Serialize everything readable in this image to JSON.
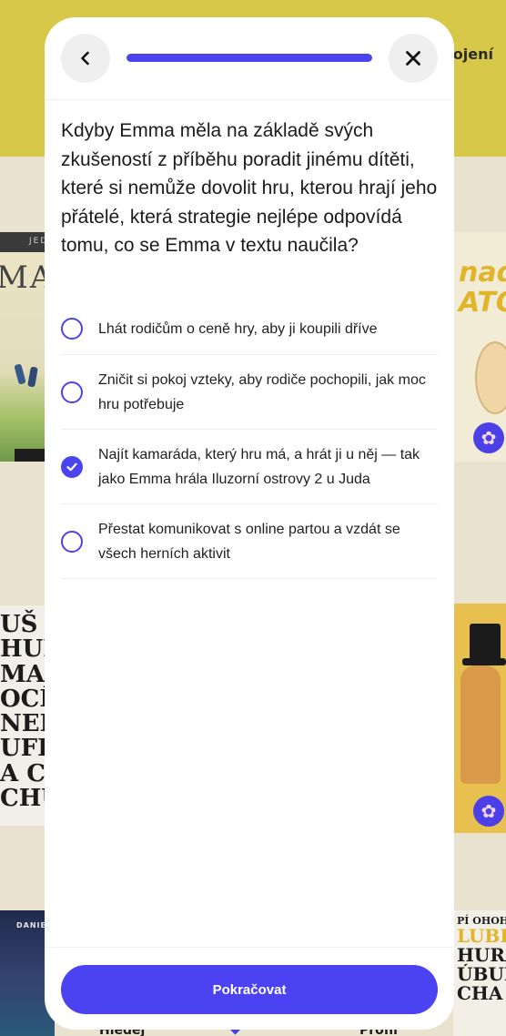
{
  "background": {
    "top_label": "ojení",
    "books_left": [
      {
        "band": "JEDE",
        "title": "MAT"
      },
      {
        "scrawl": "UŠ H\nHURÁ\nMAC\nOCÍ\nNEN\nUFF\nA CHI\nCHŮ"
      },
      {
        "band": "DANIEL"
      }
    ],
    "books_right": [
      {
        "title": "nad\nATO"
      },
      {},
      {
        "scrawl_1": "PÍ OHOH",
        "scrawl_2": "LUBI",
        "scrawl_3": "HURÁ",
        "scrawl_4": "ÚBUB",
        "scrawl_5": "CHA"
      }
    ],
    "nav": {
      "left": "Hledej",
      "right": "Profil"
    },
    "reel_icon": "film-reel-icon"
  },
  "modal": {
    "back_icon": "chevron-left-icon",
    "close_icon": "close-icon",
    "progress": 1.0,
    "accent": "#4b43ee",
    "question": "Kdyby Emma měla na základě svých zkušeností z příběhu poradit jinému dítěti, které si nemůže dovolit hru, kterou hrají jeho přátelé, která strategie nejlépe odpovídá tomu, co se Emma v textu naučila?",
    "options": [
      {
        "label": "Lhát rodičům o ceně hry, aby ji koupili dříve",
        "selected": false
      },
      {
        "label": "Zničit si pokoj vzteky, aby rodiče pochopili, jak moc hru potřebuje",
        "selected": false
      },
      {
        "label": "Najít kamaráda, který hru má, a hrát ji u něj — tak jako Emma hrála Iluzorní ostrovy 2 u Juda",
        "selected": true
      },
      {
        "label": "Přestat komunikovat s online partou a vzdát se všech herních aktivit",
        "selected": false
      }
    ],
    "submit_label": "Pokračovat"
  }
}
